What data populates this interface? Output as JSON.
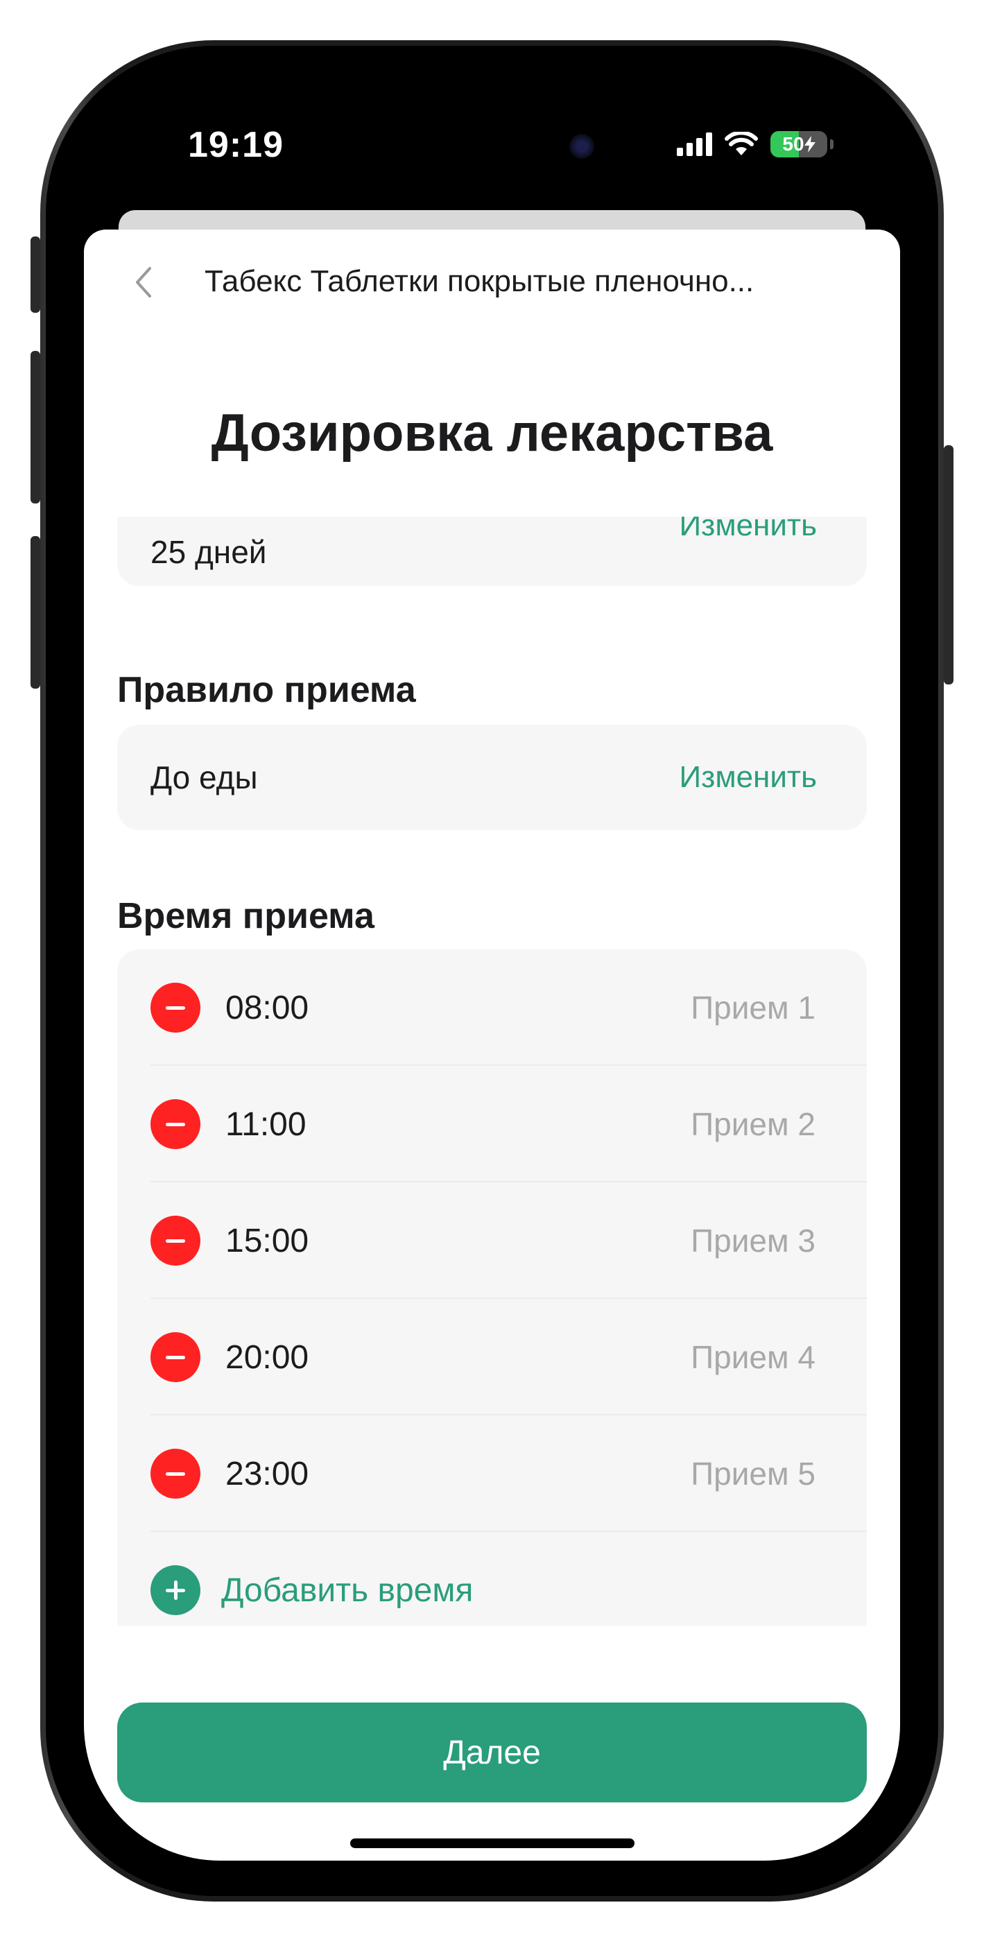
{
  "status_bar": {
    "time": "19:19",
    "battery": "50",
    "battery_level": 0.5,
    "colors": {
      "battery_fill": "#34c759"
    }
  },
  "nav": {
    "back_icon": "chevron-left-icon",
    "title": "Табекс Таблетки покрытые пленочно..."
  },
  "page": {
    "title": "Дозировка лекарства"
  },
  "duration": {
    "value": "25 дней",
    "change_label": "Изменить"
  },
  "intake_rule": {
    "label": "Правило приема",
    "value": "До еды",
    "change_label": "Изменить"
  },
  "intake_time": {
    "label": "Время приема",
    "items": [
      {
        "time": "08:00",
        "dose_label": "Прием 1"
      },
      {
        "time": "11:00",
        "dose_label": "Прием 2"
      },
      {
        "time": "15:00",
        "dose_label": "Прием 3"
      },
      {
        "time": "20:00",
        "dose_label": "Прием 4"
      },
      {
        "time": "23:00",
        "dose_label": "Прием 5"
      }
    ],
    "add_label": "Добавить время",
    "icons": {
      "remove": "minus-circle-icon",
      "add": "plus-circle-icon"
    }
  },
  "footer": {
    "next_label": "Далее"
  },
  "colors": {
    "accent": "#2a9d7b",
    "danger": "#ff2222",
    "card_bg": "#f6f6f6"
  }
}
